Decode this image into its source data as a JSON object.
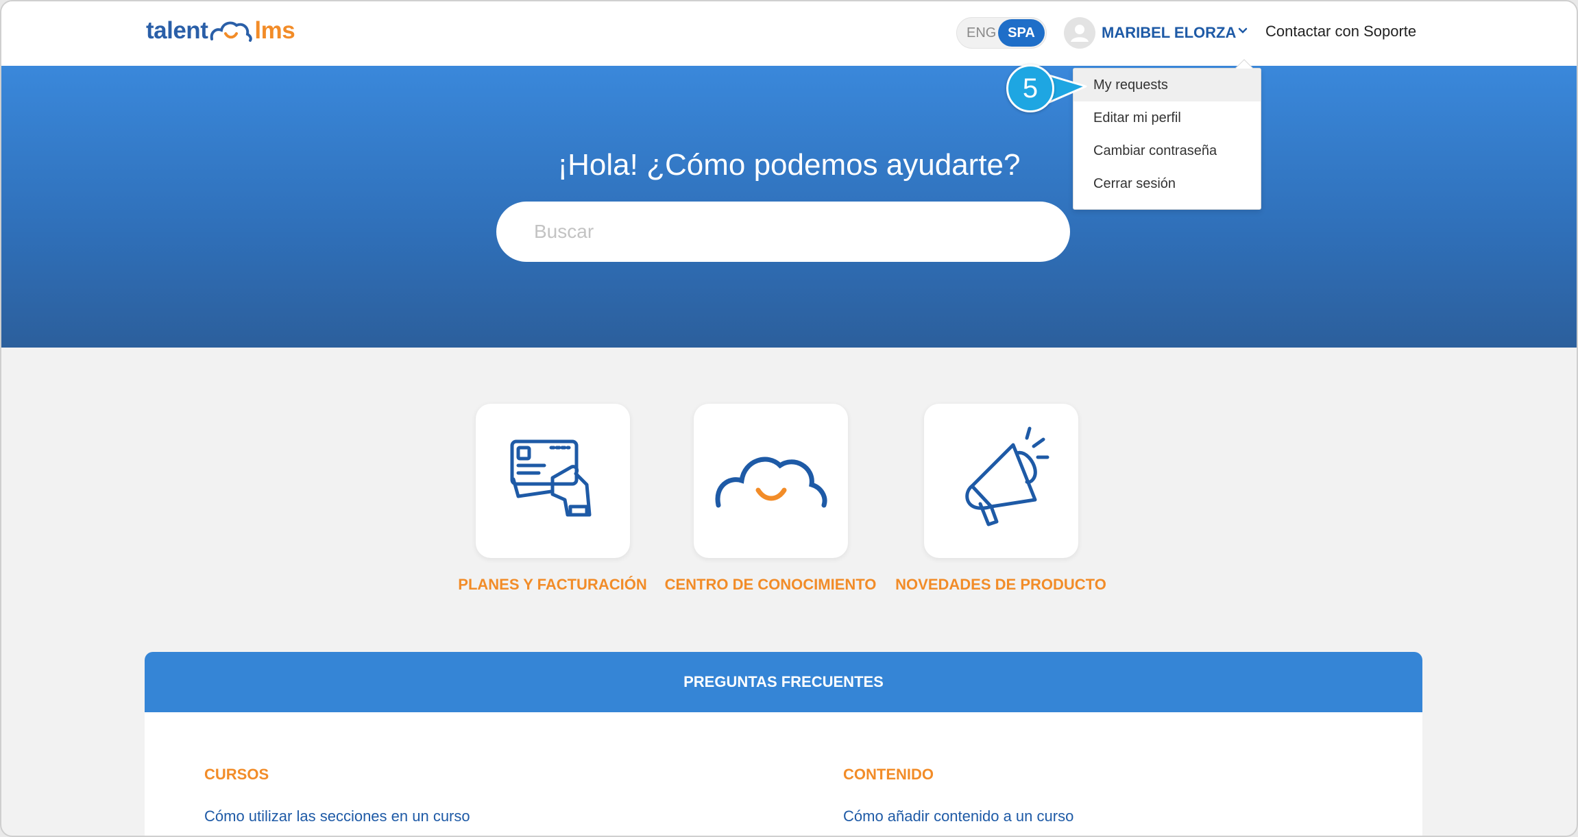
{
  "header": {
    "logo_left": "talent",
    "logo_right": "lms",
    "lang_eng": "ENG",
    "lang_spa": "SPA",
    "user_name": "MARIBEL ELORZA",
    "support_link": "Contactar con Soporte"
  },
  "hero": {
    "title": "¡Hola! ¿Cómo podemos ayudarte?",
    "search_placeholder": "Buscar"
  },
  "user_menu": {
    "items": [
      {
        "label": "My requests",
        "highlighted": true
      },
      {
        "label": "Editar mi perfil"
      },
      {
        "label": "Cambiar contraseña"
      },
      {
        "label": "Cerrar sesión"
      }
    ]
  },
  "annotation": {
    "step": "5",
    "color": "#1ea6e2"
  },
  "categories": [
    {
      "label": "PLANES Y FACTURACIÓN",
      "icon": "credit-card-hand-icon"
    },
    {
      "label": "CENTRO DE CONOCIMIENTO",
      "icon": "cloud-smile-icon"
    },
    {
      "label": "NOVEDADES DE PRODUCTO",
      "icon": "megaphone-icon"
    }
  ],
  "faq": {
    "title": "PREGUNTAS FRECUENTES",
    "columns": [
      {
        "heading": "CURSOS",
        "first_link": "Cómo utilizar las secciones en un curso"
      },
      {
        "heading": "CONTENIDO",
        "first_link": "Cómo añadir contenido a un curso"
      }
    ]
  },
  "colors": {
    "brand_blue": "#1e5aa6",
    "brand_orange": "#f28c28",
    "hero_top": "#3a88db",
    "hero_bottom": "#2c5f9c"
  }
}
